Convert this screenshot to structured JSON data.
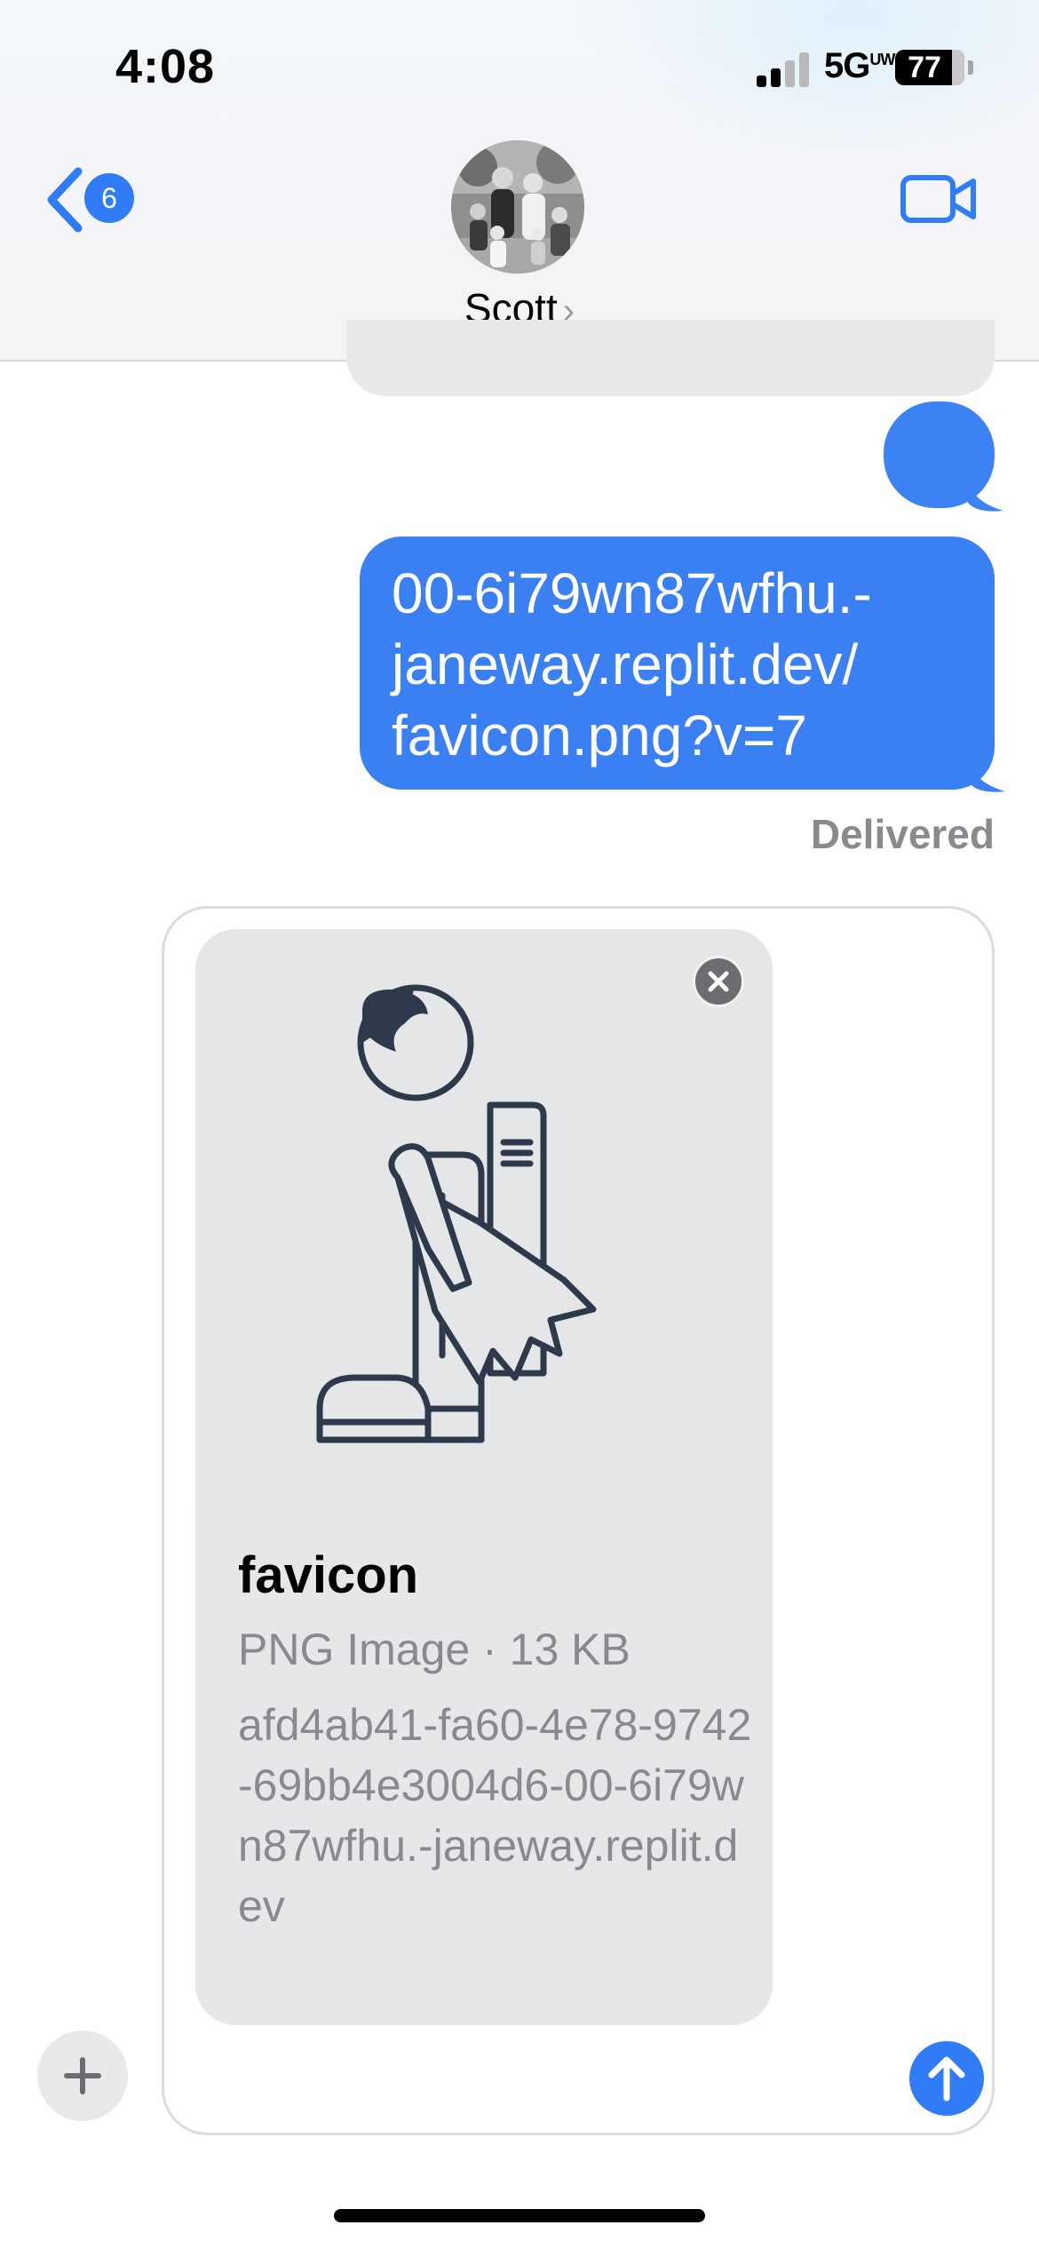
{
  "status_bar": {
    "time": "4:08",
    "network": "5G",
    "network_suffix": "UW",
    "battery": "77"
  },
  "header": {
    "back_badge": "6",
    "contact_name": "Scott",
    "chevron": "›",
    "icons": {
      "back": "chevron-left-icon",
      "video": "video-camera-icon"
    }
  },
  "messages": {
    "link_lines": [
      "00-6i79wn87wfhu.-",
      "janeway.replit.dev/",
      "favicon.png?v=7"
    ],
    "status": "Delivered"
  },
  "attachment": {
    "name": "favicon",
    "meta": "PNG Image · 13 KB",
    "source": "afd4ab41-fa60-4e78-9742-69bb4e3004d6-00-6i79wn87wfhu.-janeway.replit.dev"
  },
  "colors": {
    "accent": "#2f7cf6",
    "outgoing_bubble": "#3b80f2",
    "incoming_bubble": "#e9e9eb",
    "secondary_text": "#8a8a8e",
    "icon_ink": "#2e3a4b"
  }
}
